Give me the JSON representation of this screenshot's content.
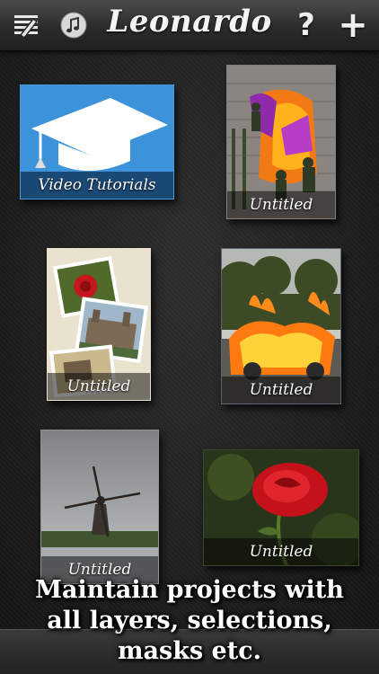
{
  "header": {
    "app_title": "Leonardo",
    "help_label": "?",
    "add_label": "+"
  },
  "tiles": [
    {
      "label": "Video Tutorials"
    },
    {
      "label": "Untitled"
    },
    {
      "label": "Untitled"
    },
    {
      "label": "Untitled"
    },
    {
      "label": "Untitled"
    },
    {
      "label": "Untitled"
    }
  ],
  "caption": {
    "line1": "Maintain projects with",
    "line2": "all layers, selections,",
    "line3": "masks etc."
  },
  "colors": {
    "tutorial_blue": "#3a8fd6",
    "background": "#1c1c1c"
  }
}
